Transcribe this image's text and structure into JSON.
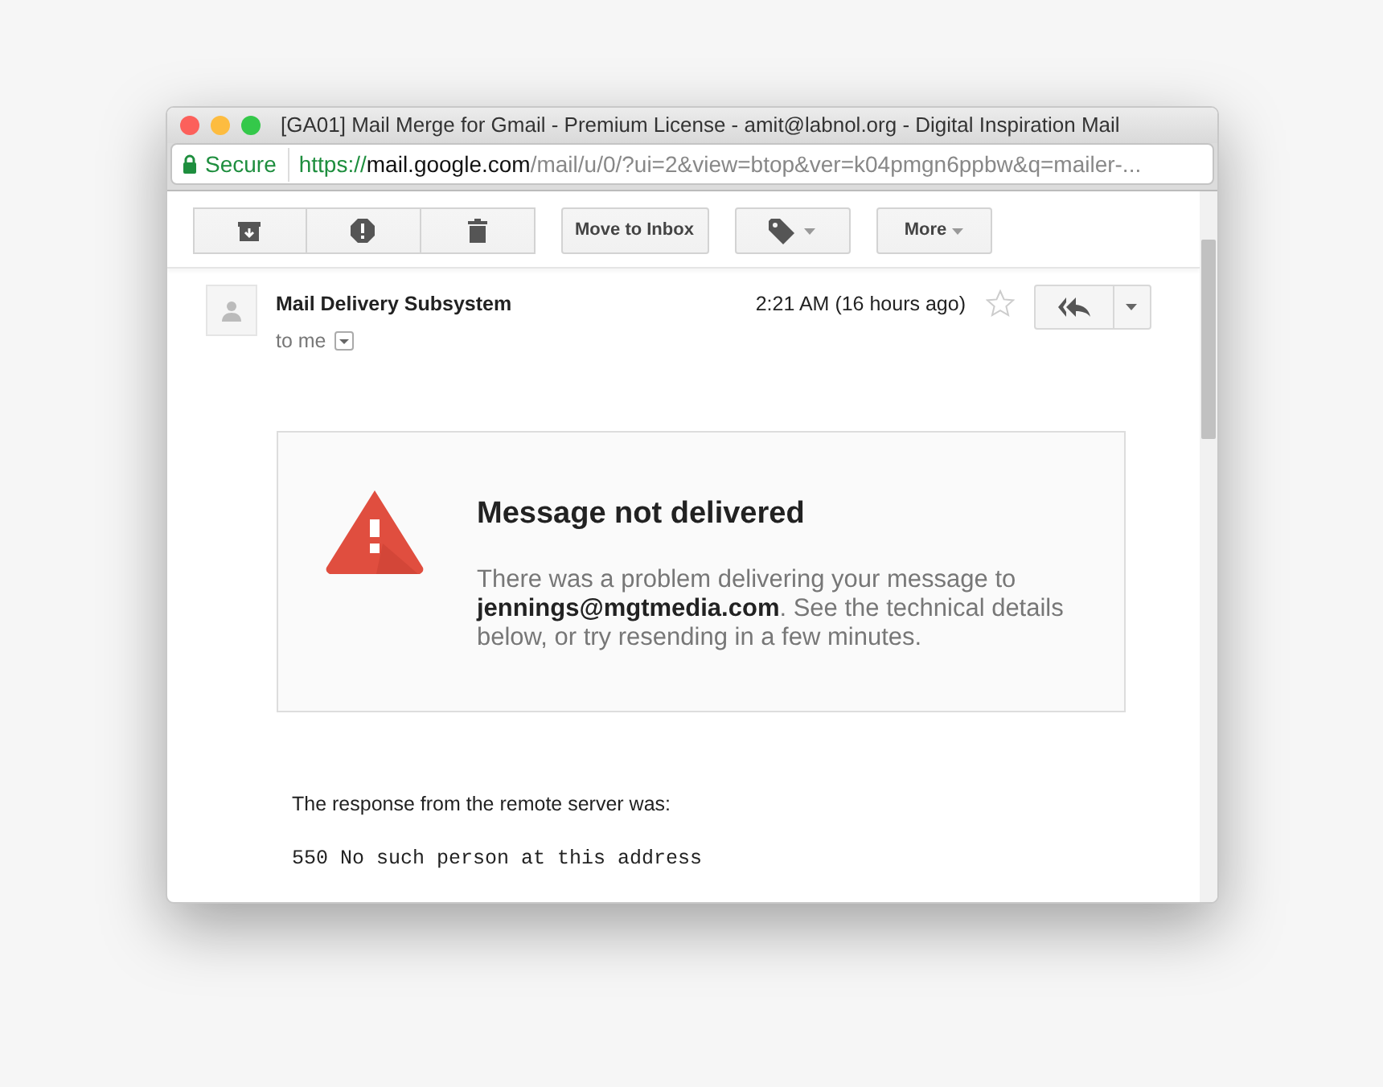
{
  "window": {
    "title": "[GA01] Mail Merge for Gmail - Premium License - amit@labnol.org - Digital Inspiration Mail"
  },
  "address": {
    "secure_label": "Secure",
    "scheme": "https://",
    "host": "mail.google.com",
    "path": "/mail/u/0/?ui=2&view=btop&ver=k04pmgn6ppbw&q=mailer-..."
  },
  "toolbar": [
    {
      "kind": "icon-group"
    },
    {
      "kind": "text",
      "label": "Move to Inbox"
    },
    {
      "kind": "labels"
    },
    {
      "kind": "menu",
      "label": "More"
    }
  ],
  "message": {
    "sender": "Mail Delivery Subsystem",
    "recipient": "to me",
    "time": "2:21 AM (16 hours ago)",
    "starred": false
  },
  "notice": {
    "title": "Message not delivered",
    "body": "There was a problem delivering your message to **jennings@mgtmedia.com**. See the technical details below, or try resending in a few minutes."
  },
  "response_label": "The response from the remote server was:",
  "response_code": "550 No such person at this address"
}
